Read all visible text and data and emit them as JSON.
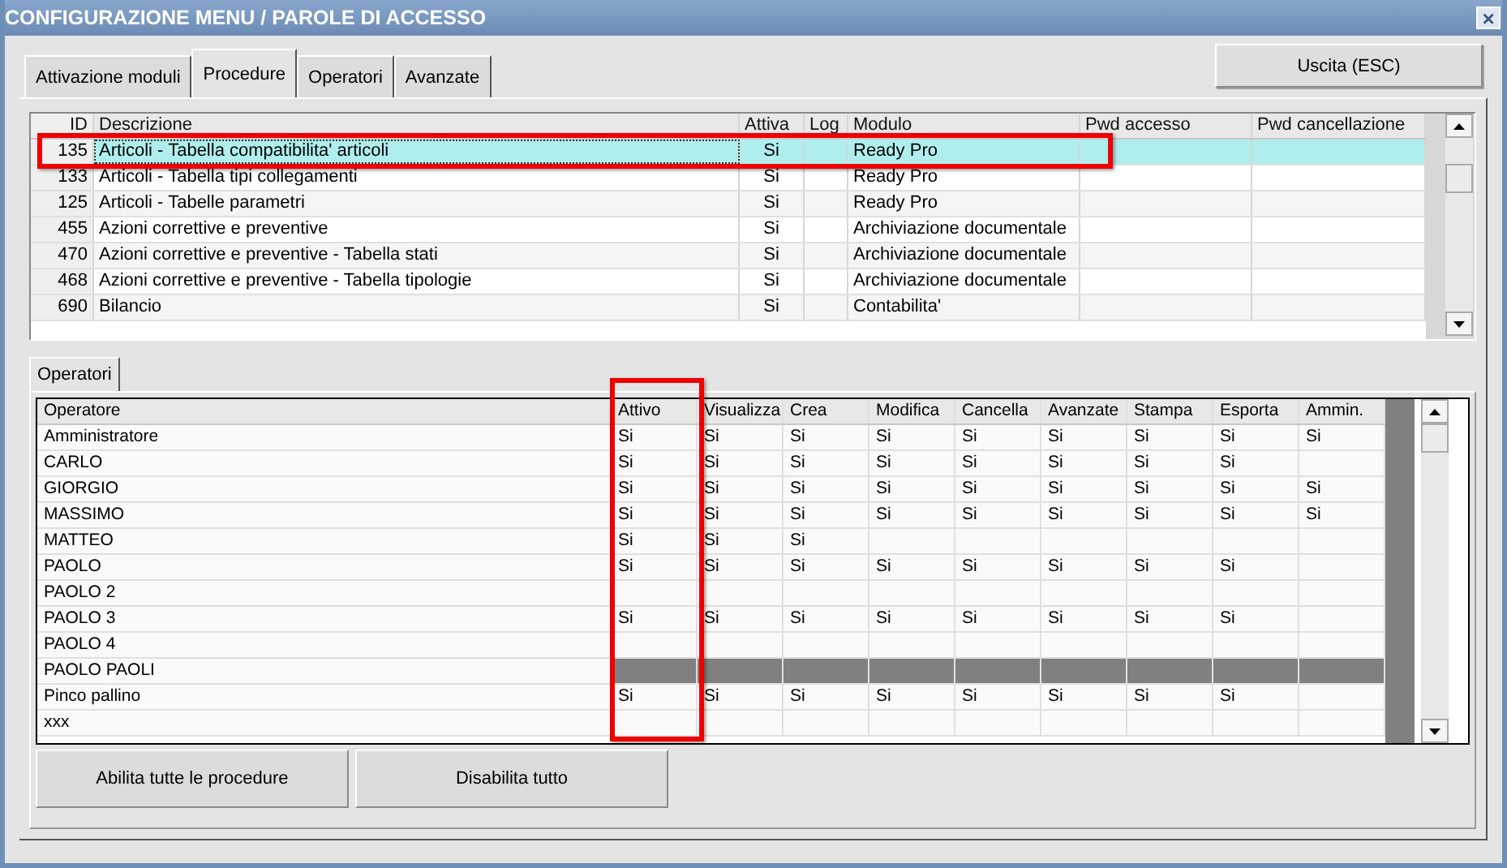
{
  "window": {
    "title": "CONFIGURAZIONE MENU / PAROLE DI ACCESSO",
    "close": "×"
  },
  "tabs": [
    {
      "label": "Attivazione moduli",
      "selected": false
    },
    {
      "label": "Procedure",
      "selected": true
    },
    {
      "label": "Operatori",
      "selected": false
    },
    {
      "label": "Avanzate",
      "selected": false
    }
  ],
  "exit_button": "Uscita (ESC)",
  "procedures": {
    "columns": [
      "ID",
      "Descrizione",
      "Attiva",
      "Log",
      "Modulo",
      "Pwd accesso",
      "Pwd cancellazione"
    ],
    "rows": [
      {
        "id": "135",
        "description": "Articoli - Tabella compatibilita' articoli",
        "active": "Si",
        "module": "Ready Pro",
        "selected": true,
        "highlighted": true
      },
      {
        "id": "133",
        "description": "Articoli - Tabella tipi collegamenti",
        "active": "Si",
        "module": "Ready Pro",
        "selected": false,
        "highlighted": false
      },
      {
        "id": "125",
        "description": "Articoli - Tabelle parametri",
        "active": "Si",
        "module": "Ready Pro",
        "selected": false,
        "highlighted": false
      },
      {
        "id": "455",
        "description": "Azioni correttive e preventive",
        "active": "Si",
        "module": "Archiviazione documentale",
        "selected": false,
        "highlighted": false
      },
      {
        "id": "470",
        "description": "Azioni correttive e preventive - Tabella stati",
        "active": "Si",
        "module": "Archiviazione documentale",
        "selected": false,
        "highlighted": false
      },
      {
        "id": "468",
        "description": "Azioni correttive e preventive - Tabella tipologie",
        "active": "Si",
        "module": "Archiviazione documentale",
        "selected": false,
        "highlighted": false
      },
      {
        "id": "690",
        "description": "Bilancio",
        "active": "Si",
        "module": "Contabilita'",
        "selected": false,
        "highlighted": false
      }
    ]
  },
  "sub_tabs": [
    {
      "label": "Operatori",
      "selected": true
    }
  ],
  "operators": {
    "columns": [
      {
        "label": "Operatore",
        "highlighted": false
      },
      {
        "label": "Attivo",
        "highlighted": true
      },
      {
        "label": "Visualizza",
        "highlighted": false
      },
      {
        "label": "Crea",
        "highlighted": false
      },
      {
        "label": "Modifica",
        "highlighted": false
      },
      {
        "label": "Cancella",
        "highlighted": false
      },
      {
        "label": "Avanzate",
        "highlighted": false
      },
      {
        "label": "Stampa",
        "highlighted": false
      },
      {
        "label": "Esporta",
        "highlighted": false
      },
      {
        "label": "Ammin.",
        "highlighted": false
      }
    ],
    "rows": [
      {
        "selected": false,
        "cells": [
          "Amministratore",
          "Si",
          "Si",
          "Si",
          "Si",
          "Si",
          "Si",
          "Si",
          "Si",
          "Si"
        ]
      },
      {
        "selected": false,
        "cells": [
          "CARLO",
          "Si",
          "Si",
          "Si",
          "Si",
          "Si",
          "Si",
          "Si",
          "Si",
          null
        ]
      },
      {
        "selected": false,
        "cells": [
          "GIORGIO",
          "Si",
          "Si",
          "Si",
          "Si",
          "Si",
          "Si",
          "Si",
          "Si",
          "Si"
        ]
      },
      {
        "selected": false,
        "cells": [
          "MASSIMO",
          "Si",
          "Si",
          "Si",
          "Si",
          "Si",
          "Si",
          "Si",
          "Si",
          "Si"
        ]
      },
      {
        "selected": false,
        "cells": [
          "MATTEO",
          "Si",
          "Si",
          "Si",
          null,
          null,
          null,
          null,
          null,
          null
        ]
      },
      {
        "selected": false,
        "cells": [
          "PAOLO",
          "Si",
          "Si",
          "Si",
          "Si",
          "Si",
          "Si",
          "Si",
          "Si",
          null
        ]
      },
      {
        "selected": false,
        "cells": [
          "PAOLO 2",
          null,
          null,
          null,
          null,
          null,
          null,
          null,
          null,
          null
        ]
      },
      {
        "selected": false,
        "cells": [
          "PAOLO 3",
          "Si",
          "Si",
          "Si",
          "Si",
          "Si",
          "Si",
          "Si",
          "Si",
          null
        ]
      },
      {
        "selected": false,
        "cells": [
          "PAOLO 4",
          null,
          null,
          null,
          null,
          null,
          null,
          null,
          null,
          null
        ]
      },
      {
        "selected": true,
        "cells": [
          "PAOLO PAOLI",
          null,
          null,
          null,
          null,
          null,
          null,
          null,
          null,
          null
        ]
      },
      {
        "selected": false,
        "cells": [
          "Pinco pallino",
          "Si",
          "Si",
          "Si",
          "Si",
          "Si",
          "Si",
          "Si",
          "Si",
          null
        ]
      },
      {
        "selected": false,
        "cells": [
          "xxx",
          null,
          null,
          null,
          null,
          null,
          null,
          null,
          null,
          null
        ]
      }
    ]
  },
  "buttons": [
    "Abilita tutte le procedure",
    "Disabilita tutto"
  ]
}
